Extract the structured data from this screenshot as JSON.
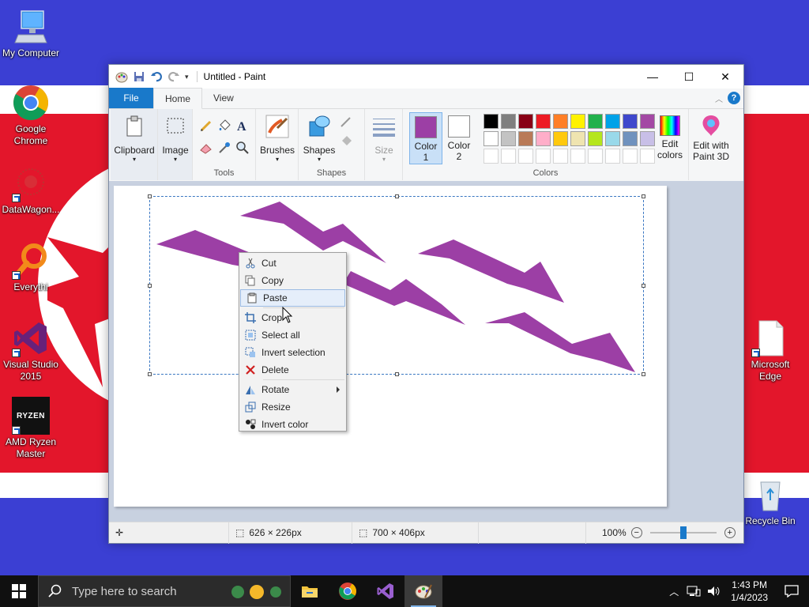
{
  "desktop": {
    "icons": [
      {
        "label": "My Computer"
      },
      {
        "label": "Google Chrome"
      },
      {
        "label": "DataWagon..."
      },
      {
        "label": "Everythi"
      },
      {
        "label": "Visual Studio 2015"
      },
      {
        "label": "AMD Ryzen Master"
      },
      {
        "label": "Microsoft Edge"
      },
      {
        "label": "Recycle Bin"
      }
    ],
    "ryzen_logo_text": "RYZEN"
  },
  "window": {
    "title": "Untitled - Paint",
    "controls": {
      "minimize": "—",
      "maximize": "☐",
      "close": "✕"
    }
  },
  "tabs": {
    "file": "File",
    "home": "Home",
    "view": "View",
    "help": "?"
  },
  "ribbon": {
    "clipboard": "Clipboard",
    "image": "Image",
    "tools": "Tools",
    "brushes": "Brushes",
    "shapes_btn": "Shapes",
    "shapes_group": "Shapes",
    "size": "Size",
    "color1": "Color\n1",
    "color1_line1": "Color",
    "color1_line2": "1",
    "color2_line1": "Color",
    "color2_line2": "2",
    "colors_group": "Colors",
    "edit_colors_line1": "Edit",
    "edit_colors_line2": "colors",
    "edit_3d_line1": "Edit with",
    "edit_3d_line2": "Paint 3D",
    "color1_value": "#9c3fa5",
    "color2_value": "#ffffff",
    "palette_row1": [
      "#000000",
      "#7f7f7f",
      "#880015",
      "#ed1c24",
      "#ff7f27",
      "#fff200",
      "#22b14c",
      "#00a2e8",
      "#3f48cc",
      "#a349a4"
    ],
    "palette_row2": [
      "#ffffff",
      "#c3c3c3",
      "#b97a57",
      "#ffaec9",
      "#ffc90e",
      "#efe4b0",
      "#b5e61d",
      "#99d9ea",
      "#7092be",
      "#c8bfe7"
    ]
  },
  "context_menu": {
    "items": [
      {
        "label": "Cut",
        "icon": "scissors-icon"
      },
      {
        "label": "Copy",
        "icon": "copy-icon"
      },
      {
        "label": "Paste",
        "icon": "paste-icon"
      },
      {
        "label": "Crop",
        "icon": "crop-icon"
      },
      {
        "label": "Select all",
        "icon": "select-all-icon"
      },
      {
        "label": "Invert selection",
        "icon": "invert-selection-icon"
      },
      {
        "label": "Delete",
        "icon": "delete-icon"
      },
      {
        "label": "Rotate",
        "icon": "rotate-icon"
      },
      {
        "label": "Resize",
        "icon": "resize-icon"
      },
      {
        "label": "Invert color",
        "icon": "invert-color-icon"
      }
    ],
    "highlighted": "Paste"
  },
  "statusbar": {
    "selection_size": "626 × 226px",
    "canvas_size": "700 × 406px",
    "zoom": "100%"
  },
  "taskbar": {
    "search_placeholder": "Type here to search",
    "time": "1:43 PM",
    "date": "1/4/2023"
  },
  "colors": {
    "accent": "#1979ca",
    "shape_fill": "#9c3fa5"
  }
}
